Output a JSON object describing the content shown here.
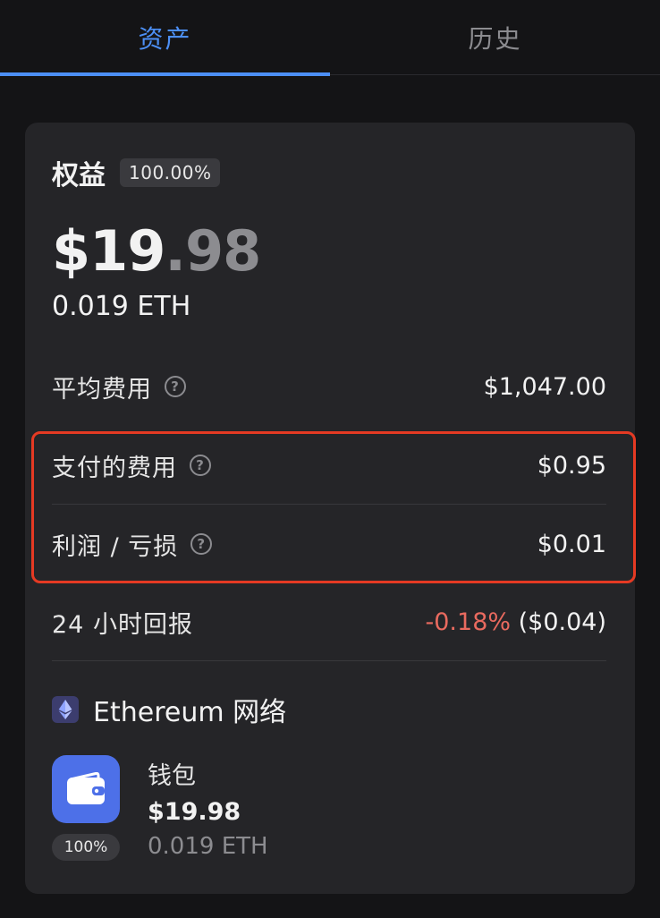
{
  "tabs": [
    {
      "label": "资产",
      "active": true
    },
    {
      "label": "历史",
      "active": false
    }
  ],
  "equity": {
    "label": "权益",
    "badge": "100.00%"
  },
  "balance": {
    "integer": "$19",
    "decimal": ".98",
    "eth": "0.019 ETH"
  },
  "stats": {
    "average_cost": {
      "label": "平均费用",
      "value": "$1,047.00"
    },
    "fees_paid": {
      "label": "支付的费用",
      "value": "$0.95"
    },
    "pnl": {
      "label": "利润 / 亏损",
      "value": "$0.01"
    },
    "return_24h": {
      "label": "24 小时回报",
      "percent": "-0.18%",
      "amount": "($0.04)"
    }
  },
  "network": {
    "label": "Ethereum 网络",
    "icon": "ethereum-icon"
  },
  "wallet": {
    "name": "钱包",
    "usd": "$19.98",
    "eth": "0.019 ETH",
    "badge": "100%",
    "icon": "wallet-icon"
  },
  "colors": {
    "accent": "#4c8ff5",
    "negative": "#e96a5f",
    "highlight": "#e53a23",
    "wallet": "#4d70e8"
  },
  "help_glyph": "?"
}
